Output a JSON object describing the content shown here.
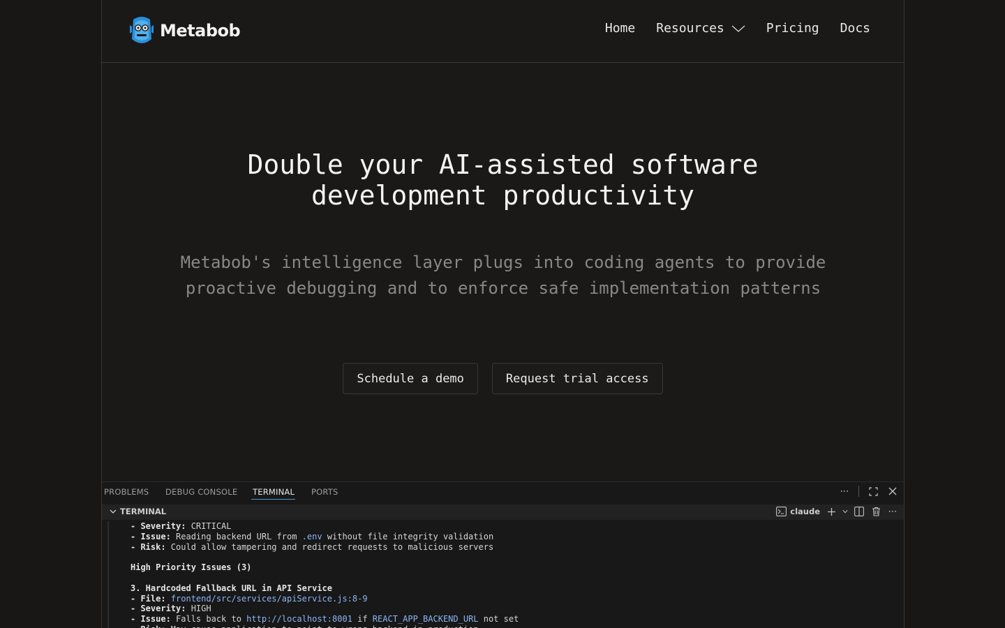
{
  "header": {
    "brand": "Metabob",
    "nav": [
      {
        "label": "Home"
      },
      {
        "label": "Resources",
        "has_dropdown": true
      },
      {
        "label": "Pricing"
      },
      {
        "label": "Docs"
      }
    ]
  },
  "hero": {
    "title_line1": "Double your AI-assisted software",
    "title_line2": "development productivity",
    "subtitle": "Metabob's intelligence layer plugs into coding agents to provide proactive debugging and to enforce safe implementation patterns",
    "primary_button": "Schedule a demo",
    "secondary_button": "Request trial access"
  },
  "panel": {
    "tabs": [
      "PROBLEMS",
      "DEBUG CONSOLE",
      "TERMINAL",
      "PORTS"
    ],
    "active_tab": "TERMINAL",
    "terminal_title": "TERMINAL",
    "shell_name": "claude",
    "lines": [
      {
        "label": "- Severity:",
        "rest": " CRITICAL"
      },
      {
        "label": "- Issue:",
        "rest": " Reading backend URL from ",
        "link": ".env",
        "tail": " without file integrity validation"
      },
      {
        "label": "- Risk:",
        "rest": " Could allow tampering and redirect requests to malicious servers"
      },
      {
        "blank": true
      },
      {
        "heading": "High Priority Issues (3)"
      },
      {
        "blank": true
      },
      {
        "heading": "3. Hardcoded Fallback URL in API Service"
      },
      {
        "label": "- File:",
        "rest": " ",
        "link": "frontend/src/services/apiService.js:8-9"
      },
      {
        "label": "- Severity:",
        "rest": " HIGH"
      },
      {
        "label": "- Issue:",
        "rest": " Falls back to ",
        "link": "http://localhost:8001",
        "tail": " if ",
        "link2": "REACT_APP_BACKEND_URL",
        "tail2": " not set"
      },
      {
        "label": "- Risk:",
        "rest": " May cause application to point to wrong backend in production"
      }
    ]
  },
  "colors": {
    "background": "#181716",
    "accent_tab": "#4a9bd8",
    "link": "#8db4f3",
    "subtitle": "#8a8784"
  }
}
